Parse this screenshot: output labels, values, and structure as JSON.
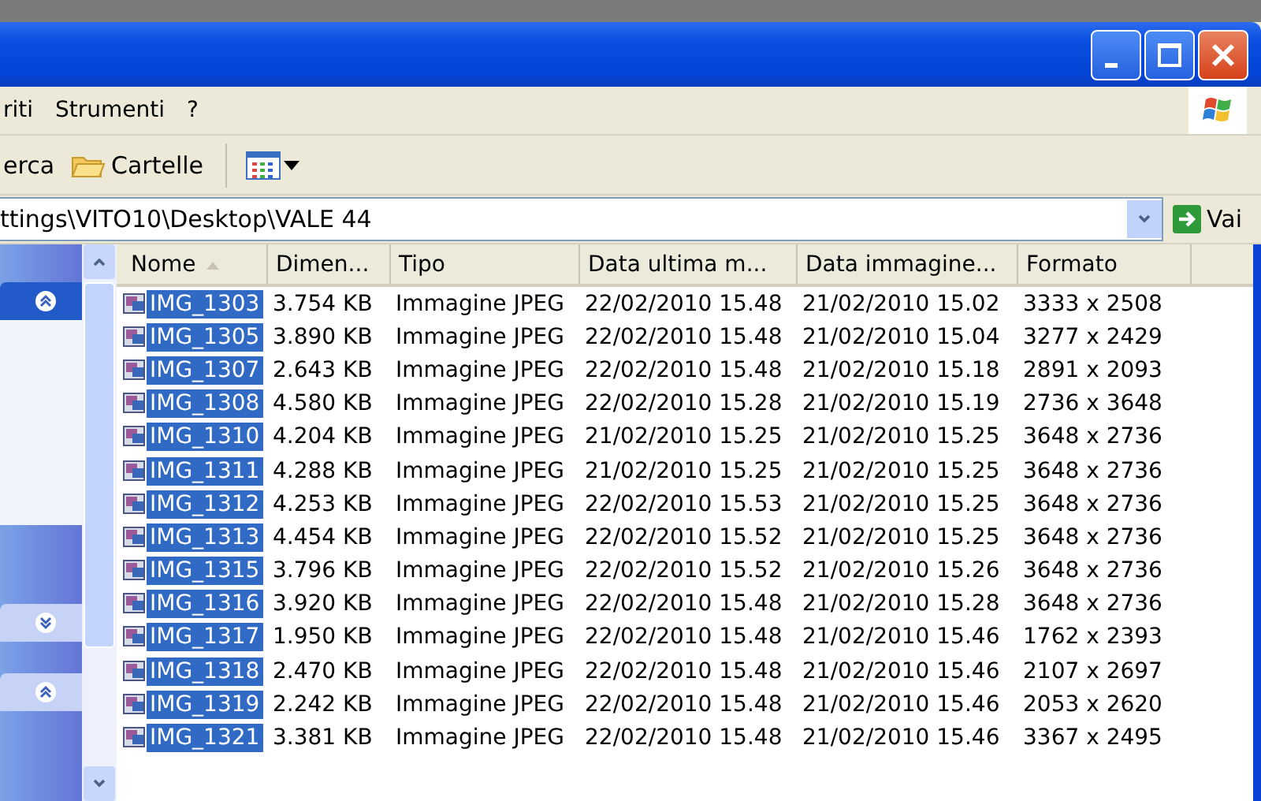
{
  "menu": {
    "items": [
      "riti",
      "Strumenti",
      "?"
    ]
  },
  "toolbar": {
    "items": [
      {
        "kind": "text",
        "label": "erca"
      },
      {
        "kind": "folders",
        "label": "Cartelle"
      },
      {
        "kind": "views"
      }
    ]
  },
  "address": {
    "value": "ttings\\VITO10\\Desktop\\VALE 44",
    "go": "Vai"
  },
  "task_pane": {
    "panels": [
      {
        "expanded": true
      },
      {
        "expanded": false
      },
      {
        "expanded": true
      }
    ]
  },
  "table": {
    "columns": [
      {
        "label": "Nome",
        "sorted": true
      },
      {
        "label": "Dimen...",
        "sorted": false
      },
      {
        "label": "Tipo",
        "sorted": false
      },
      {
        "label": "Data ultima m...",
        "sorted": false
      },
      {
        "label": "Data immagine...",
        "sorted": false
      },
      {
        "label": "Formato",
        "sorted": false
      }
    ],
    "rows": [
      {
        "selected": true,
        "cells": [
          "IMG_1303",
          "3.754 KB",
          "Immagine JPEG",
          "22/02/2010 15.48",
          "21/02/2010 15.02",
          "3333 x 2508"
        ]
      },
      {
        "selected": true,
        "cells": [
          "IMG_1305",
          "3.890 KB",
          "Immagine JPEG",
          "22/02/2010 15.48",
          "21/02/2010 15.04",
          "3277 x 2429"
        ]
      },
      {
        "selected": true,
        "cells": [
          "IMG_1307",
          "2.643 KB",
          "Immagine JPEG",
          "22/02/2010 15.48",
          "21/02/2010 15.18",
          "2891 x 2093"
        ]
      },
      {
        "selected": true,
        "cells": [
          "IMG_1308",
          "4.580 KB",
          "Immagine JPEG",
          "22/02/2010 15.28",
          "21/02/2010 15.19",
          "2736 x 3648"
        ]
      },
      {
        "selected": true,
        "cells": [
          "IMG_1310",
          "4.204 KB",
          "Immagine JPEG",
          "21/02/2010 15.25",
          "21/02/2010 15.25",
          "3648 x 2736"
        ]
      },
      {
        "selected": true,
        "cells": [
          "IMG_1311",
          "4.288 KB",
          "Immagine JPEG",
          "21/02/2010 15.25",
          "21/02/2010 15.25",
          "3648 x 2736"
        ]
      },
      {
        "selected": true,
        "cells": [
          "IMG_1312",
          "4.253 KB",
          "Immagine JPEG",
          "22/02/2010 15.53",
          "21/02/2010 15.25",
          "3648 x 2736"
        ]
      },
      {
        "selected": true,
        "cells": [
          "IMG_1313",
          "4.454 KB",
          "Immagine JPEG",
          "22/02/2010 15.52",
          "21/02/2010 15.25",
          "3648 x 2736"
        ]
      },
      {
        "selected": true,
        "cells": [
          "IMG_1315",
          "3.796 KB",
          "Immagine JPEG",
          "22/02/2010 15.52",
          "21/02/2010 15.26",
          "3648 x 2736"
        ]
      },
      {
        "selected": true,
        "cells": [
          "IMG_1316",
          "3.920 KB",
          "Immagine JPEG",
          "22/02/2010 15.48",
          "21/02/2010 15.28",
          "3648 x 2736"
        ]
      },
      {
        "selected": true,
        "cells": [
          "IMG_1317",
          "1.950 KB",
          "Immagine JPEG",
          "22/02/2010 15.48",
          "21/02/2010 15.46",
          "1762 x 2393"
        ]
      },
      {
        "selected": true,
        "cells": [
          "IMG_1318",
          "2.470 KB",
          "Immagine JPEG",
          "22/02/2010 15.48",
          "21/02/2010 15.46",
          "2107 x 2697"
        ]
      },
      {
        "selected": true,
        "cells": [
          "IMG_1319",
          "2.242 KB",
          "Immagine JPEG",
          "22/02/2010 15.48",
          "21/02/2010 15.46",
          "2053 x 2620"
        ]
      },
      {
        "selected": true,
        "cells": [
          "IMG_1321",
          "3.381 KB",
          "Immagine JPEG",
          "22/02/2010 15.48",
          "21/02/2010 15.46",
          "3367 x 2495"
        ]
      }
    ]
  }
}
